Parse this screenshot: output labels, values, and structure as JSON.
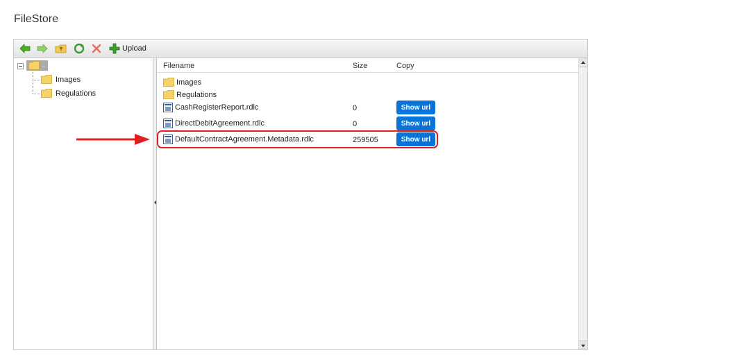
{
  "page": {
    "title": "FileStore"
  },
  "toolbar": {
    "icons": [
      "back-arrow-icon",
      "forward-arrow-icon",
      "folder-up-icon",
      "refresh-icon",
      "delete-icon",
      "plus-icon"
    ],
    "upload_label": "Upload"
  },
  "tree": {
    "root_label": "..",
    "items": [
      {
        "label": "Images"
      },
      {
        "label": "Regulations"
      }
    ]
  },
  "grid": {
    "columns": {
      "filename": "Filename",
      "size": "Size",
      "copy": "Copy"
    },
    "rows": [
      {
        "name": "Images",
        "type": "folder",
        "size": ""
      },
      {
        "name": "Regulations",
        "type": "folder",
        "size": ""
      },
      {
        "name": "CashRegisterReport.rdlc",
        "type": "file",
        "size": "0",
        "button": "Show url"
      },
      {
        "name": "DirectDebitAgreement.rdlc",
        "type": "file",
        "size": "0",
        "button": "Show url"
      },
      {
        "name": "DefaultContractAgreement.Metadata.rdlc",
        "type": "file",
        "size": "259505",
        "button": "Show url"
      }
    ]
  },
  "colors": {
    "button_blue": "#0a73d8",
    "annotation_red": "#e02020",
    "selection_gray": "#aaaaaa"
  }
}
